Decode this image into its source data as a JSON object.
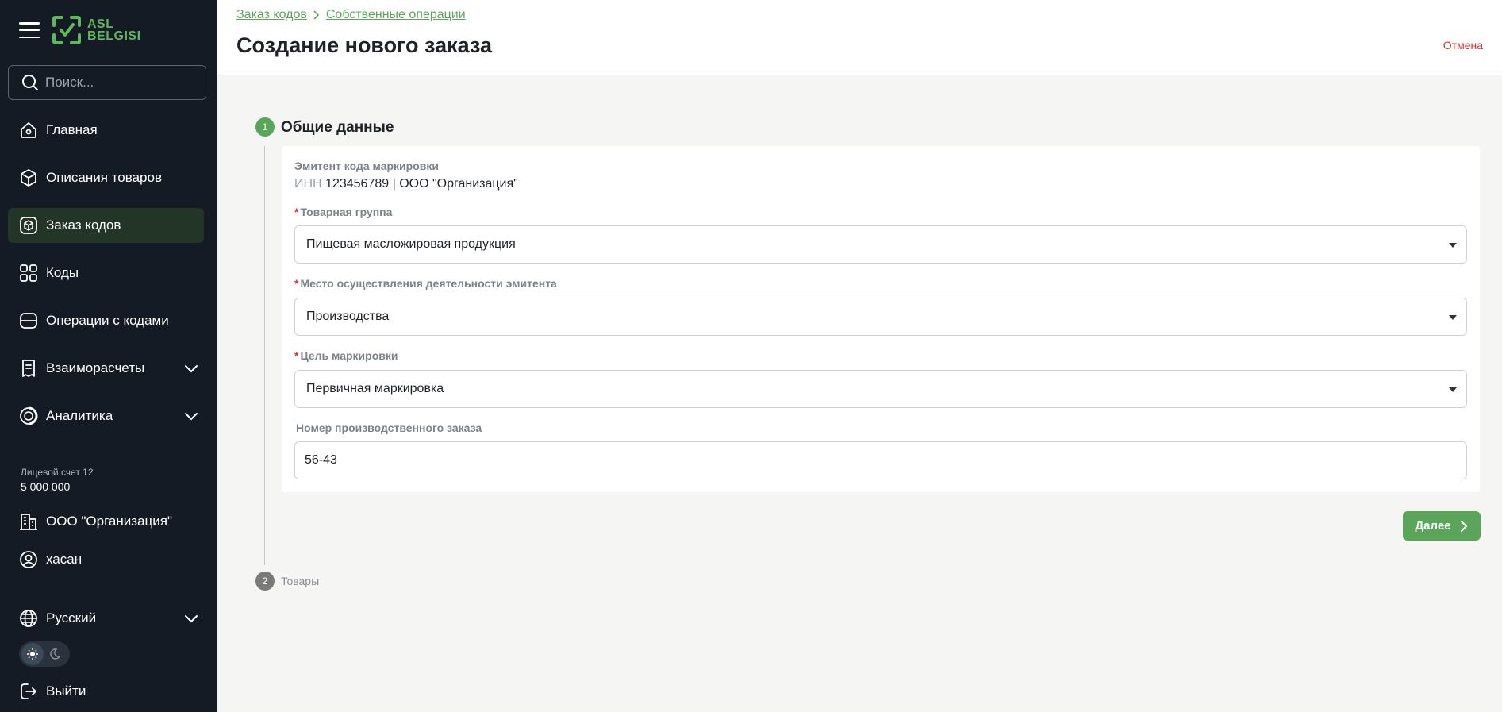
{
  "logo": {
    "line1": "ASL",
    "line2": "BELGISI"
  },
  "search": {
    "placeholder": "Поиск..."
  },
  "sidebar": {
    "items": [
      {
        "label": "Главная",
        "icon": "home-icon"
      },
      {
        "label": "Описания товаров",
        "icon": "box-icon"
      },
      {
        "label": "Заказ кодов",
        "icon": "code-order-icon",
        "active": true
      },
      {
        "label": "Коды",
        "icon": "qr-icon"
      },
      {
        "label": "Операции с кодами",
        "icon": "operations-icon"
      },
      {
        "label": "Взаиморасчеты",
        "icon": "receipt-icon",
        "expandable": true
      },
      {
        "label": "Аналитика",
        "icon": "analytics-icon",
        "expandable": true
      }
    ],
    "account": {
      "label": "Лицевой счет 12",
      "value": "5 000 000"
    },
    "org": "ООО \"Организация\"",
    "user": "хасан",
    "language": "Русский",
    "logout": "Выйти"
  },
  "header": {
    "breadcrumb": [
      "Заказ кодов",
      "Собственные операции"
    ],
    "title": "Создание нового заказа",
    "cancel": "Отмена"
  },
  "steps": [
    {
      "number": "1",
      "title": "Общие данные",
      "active": true
    },
    {
      "number": "2",
      "title": "Товары",
      "active": false
    }
  ],
  "form": {
    "emitter": {
      "label": "Эмитент кода маркировки",
      "inn_prefix": "ИНН",
      "value": "123456789 | ООО \"Организация\""
    },
    "product_group": {
      "label": "Товарная группа",
      "required": true,
      "value": "Пищевая масложировая продукция"
    },
    "activity_place": {
      "label": "Место осуществления деятельности эмитента",
      "required": true,
      "value": "Производства"
    },
    "marking_goal": {
      "label": "Цель маркировки",
      "required": true,
      "value": "Первичная маркировка"
    },
    "production_order": {
      "label": "Номер производственного заказа",
      "value": "56-43"
    }
  },
  "next_button": "Далее",
  "colors": {
    "accent": "#5aa55a",
    "sidebar_bg": "#141b24",
    "danger": "#d23232"
  }
}
